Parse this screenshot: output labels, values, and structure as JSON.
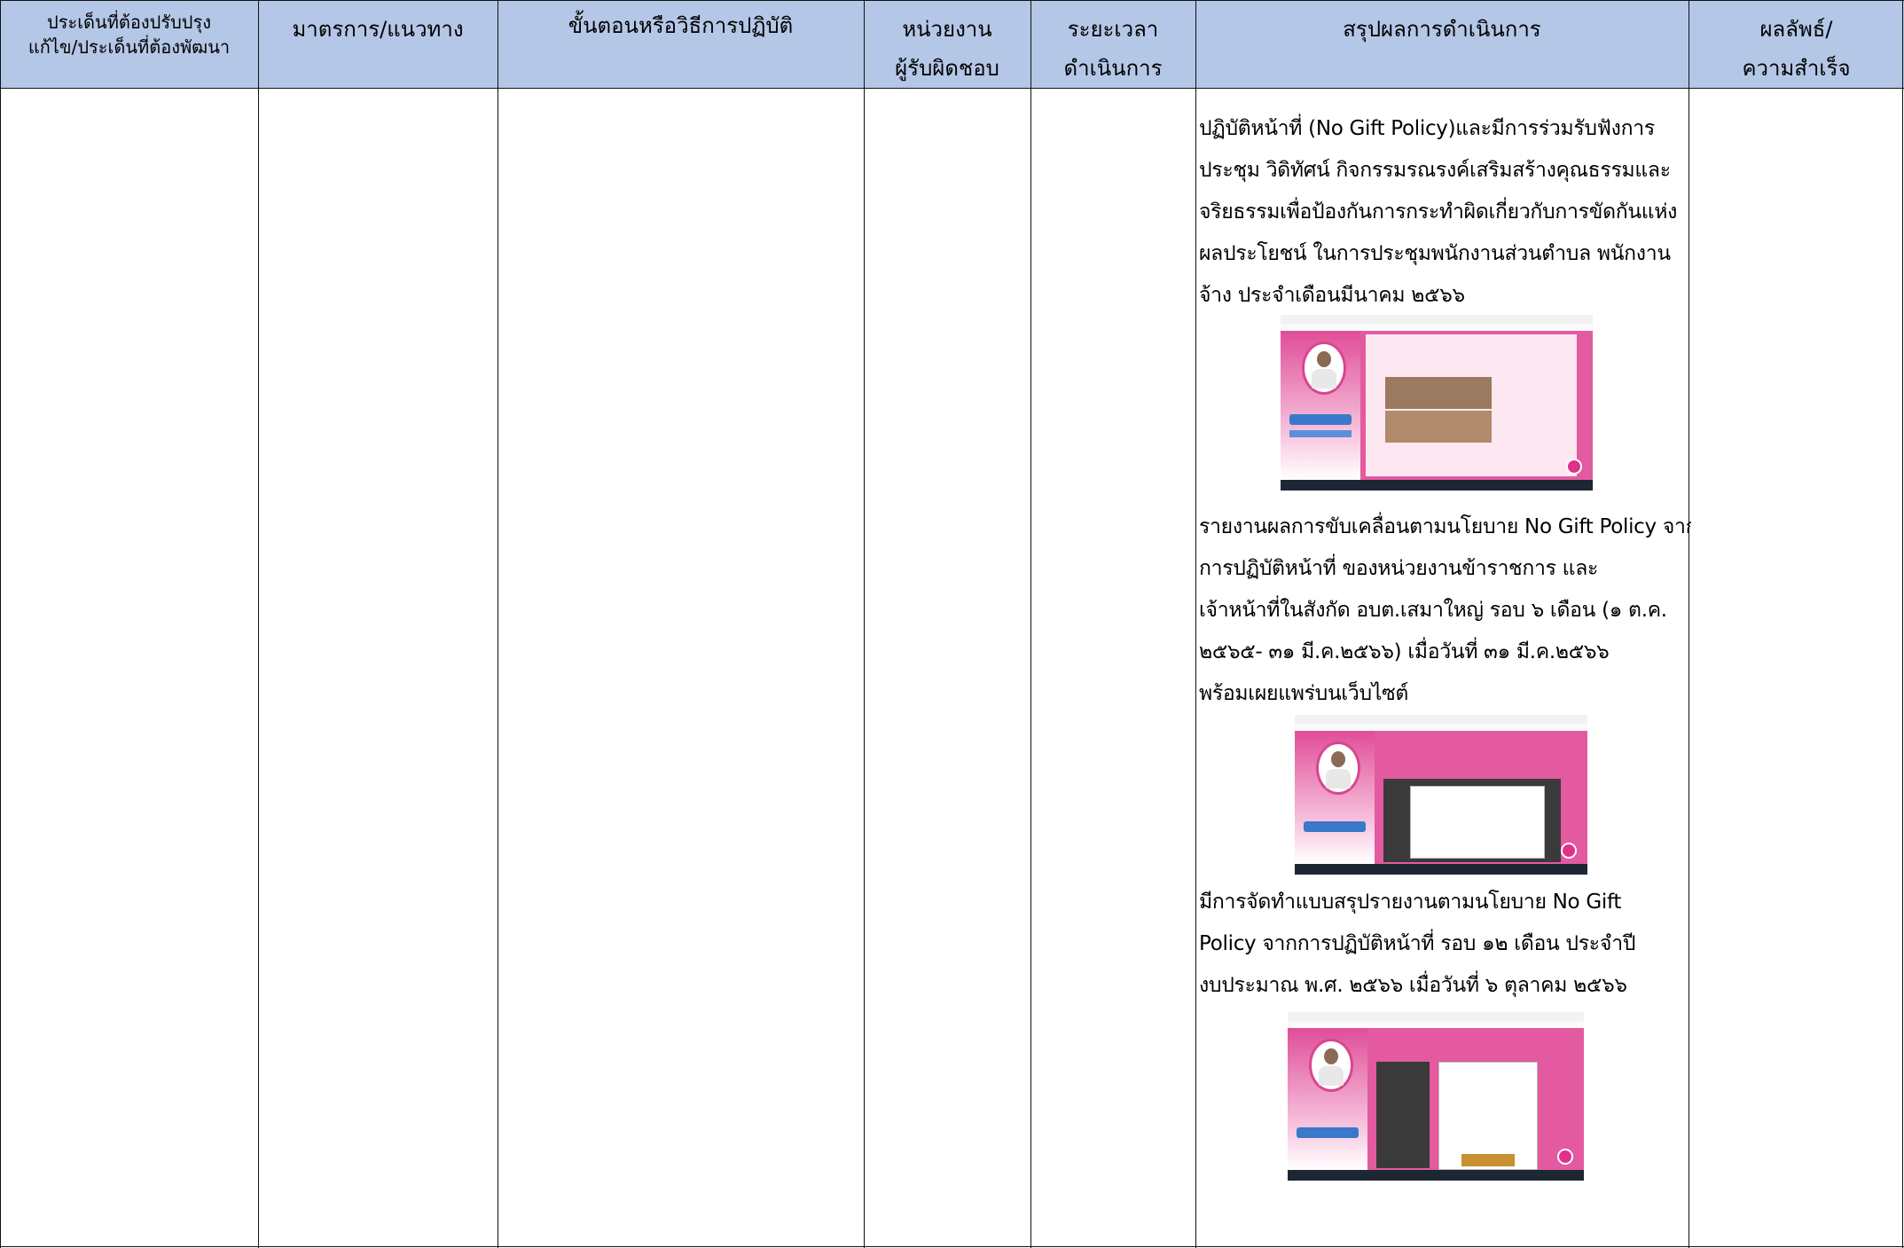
{
  "header": {
    "col1": [
      "ประเด็นที่ต้องปรับปรุง",
      "แก้ไข/ประเด็นที่ต้องพัฒนา"
    ],
    "col2": "มาตรการ/แนวทาง",
    "col3": "ขั้นตอนหรือวิธีการปฏิบัติ",
    "col4": [
      "หน่วยงาน",
      "ผู้รับผิดชอบ"
    ],
    "col5": [
      "ระยะเวลา",
      "ดำเนินการ"
    ],
    "col6": "สรุปผลการดำเนินการ",
    "col7": [
      "ผลลัพธ์/",
      "ความสำเร็จ"
    ]
  },
  "results": {
    "para1": [
      "ปฏิบัติหน้าที่ (No Gift Policy)และมีการร่วมรับฟังการ",
      "ประชุม วิดิทัศน์ กิจกรรมรณรงค์เสริมสร้างคุณธรรมและ",
      "จริยธรรมเพื่อป้องกันการกระทำผิดเกี่ยวกับการขัดกันแห่ง",
      "ผลประโยชน์ ในการประชุมพนักงานส่วนตำบล พนักงาน",
      "จ้าง ประจำเดือนมีนาคม ๒๕๖๖"
    ],
    "para2": [
      "รายงานผลการขับเคลื่อนตามนโยบาย No Gift Policy จาก",
      "การปฏิบัติหน้าที่ ของหน่วยงานข้าราชการ และ",
      "เจ้าหน้าที่ในสังกัด อบต.เสมาใหญ่ รอบ ๖ เดือน (๑ ต.ค.",
      "๒๕๖๕- ๓๑ มี.ค.๒๕๖๖) เมื่อวันที่ ๓๑ มี.ค.๒๕๖๖",
      "พร้อมเผยแพร่บนเว็บไซต์"
    ],
    "para3": [
      "มีการจัดทำแบบสรุปรายงานตามนโยบาย No Gift",
      "Policy จากการปฏิบัติหน้าที่ รอบ ๑๒ เดือน ประจำปี",
      "งบประมาณ พ.ศ. ๒๕๖๖ เมื่อวันที่ ๖ ตุลาคม ๒๕๖๖"
    ]
  },
  "colors": {
    "header_bg": "#b4c7e7",
    "site_pink": "#e35aa0"
  }
}
